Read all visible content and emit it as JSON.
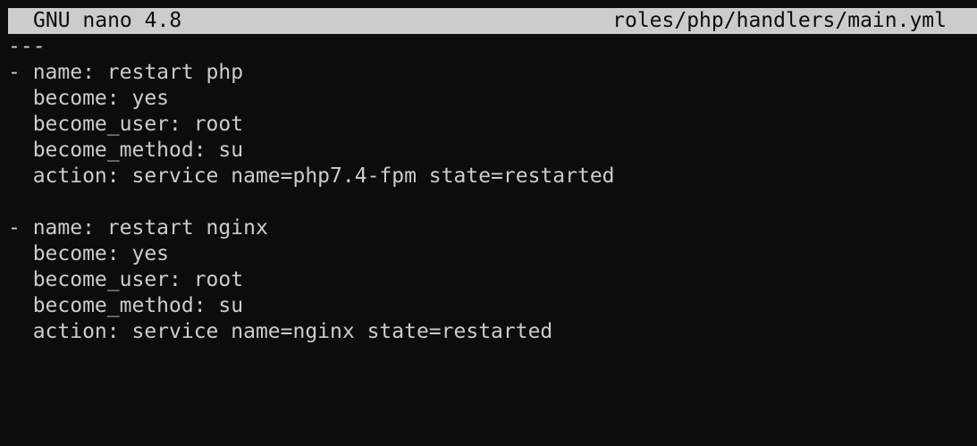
{
  "titlebar": {
    "app": "GNU nano 4.8",
    "file": "roles/php/handlers/main.yml"
  },
  "colors": {
    "background": "#0c0c0c",
    "foreground": "#cccccc",
    "titlebar_bg": "#cccccc",
    "titlebar_fg": "#0c0c0c"
  },
  "editor": {
    "lines": [
      "---",
      "- name: restart php",
      "  become: yes",
      "  become_user: root",
      "  become_method: su",
      "  action: service name=php7.4-fpm state=restarted",
      "",
      "- name: restart nginx",
      "  become: yes",
      "  become_user: root",
      "  become_method: su",
      "  action: service name=nginx state=restarted"
    ]
  }
}
